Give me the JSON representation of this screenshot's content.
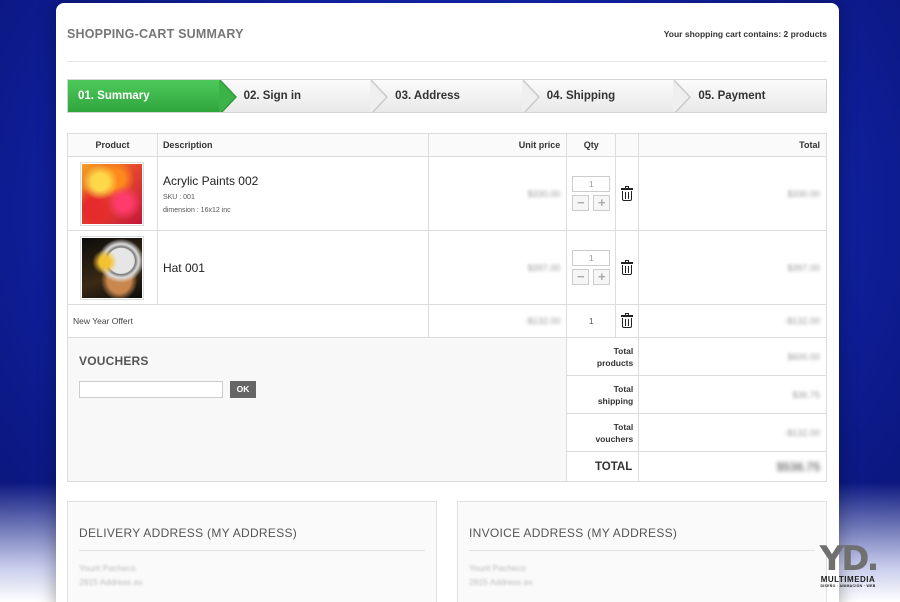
{
  "header": {
    "title": "SHOPPING-CART SUMMARY",
    "cart_count": "Your shopping cart contains: 2 products"
  },
  "steps": [
    {
      "label": "01. Summary",
      "active": true
    },
    {
      "label": "02. Sign in",
      "active": false
    },
    {
      "label": "03. Address",
      "active": false
    },
    {
      "label": "04. Shipping",
      "active": false
    },
    {
      "label": "05. Payment",
      "active": false
    }
  ],
  "table": {
    "headers": {
      "product": "Product",
      "description": "Description",
      "unit_price": "Unit price",
      "qty": "Qty",
      "total": "Total"
    },
    "items": [
      {
        "name": "Acrylic Paints 002",
        "sku": "SKU : 001",
        "attribute": "dimension : 16x12 inc",
        "unit_price": "$330.00",
        "qty": "1",
        "total": "$330.00",
        "image": "acrylic-paint-thumbnail"
      },
      {
        "name": "Hat 001",
        "unit_price": "$397.00",
        "qty": "1",
        "total": "$397.00",
        "image": "hat-thumbnail"
      }
    ],
    "voucher_row": {
      "name": "New Year Offert",
      "unit_price": "-$132.00",
      "qty": "1",
      "total": "-$132.00"
    }
  },
  "vouchers": {
    "title": "VOUCHERS",
    "input_value": "",
    "button_label": "OK"
  },
  "totals": {
    "products_label_1": "Total",
    "products_label_2": "products",
    "products_value": "$600.00",
    "shipping_label_1": "Total",
    "shipping_label_2": "shipping",
    "shipping_value": "$36.75",
    "vouchers_label_1": "Total",
    "vouchers_label_2": "vouchers",
    "vouchers_value": "-$132.00",
    "grand_label": "TOTAL",
    "grand_value": "$536.75"
  },
  "delivery": {
    "title": "DELIVERY ADDRESS (MY ADDRESS)",
    "name": "Yourit Pacheco",
    "line": "2815 Address av."
  },
  "invoice": {
    "title": "INVOICE ADDRESS (MY ADDRESS)",
    "name": "Yourit Pacheco",
    "line": "2815 Address av."
  },
  "logo": {
    "mark": "YD.",
    "name": "MULTIMEDIA",
    "tagline": "DISEÑO · ANIMACIÓN · WEB"
  },
  "colors": {
    "active_step": "#3bb348",
    "background": "#1428b8",
    "ok_button": "#666666"
  }
}
